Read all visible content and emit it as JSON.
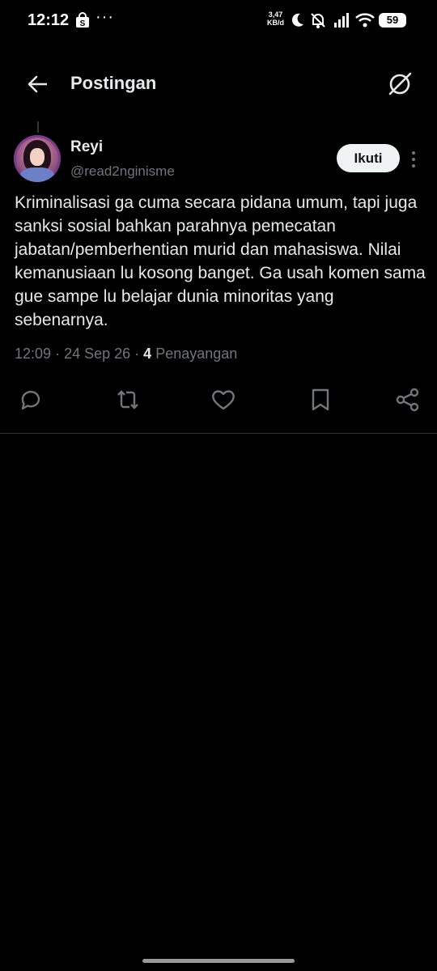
{
  "status_bar": {
    "time": "12:12",
    "dots": "···",
    "speed_value": "3,47",
    "speed_unit": "KB/d",
    "battery": "59",
    "icons": [
      "shopping-bag-icon",
      "moon-icon",
      "bell-off-icon",
      "signal-icon",
      "wifi-icon",
      "battery-icon"
    ]
  },
  "header": {
    "title": "Postingan",
    "back_icon": "arrow-left-icon",
    "grok_icon": "grok-icon"
  },
  "post": {
    "author": {
      "name": "Reyi",
      "handle": "@read2nginisme"
    },
    "follow_label": "Ikuti",
    "text": "Kriminalisasi ga cuma secara pidana umum, tapi juga sanksi sosial bahkan parahnya pemecatan jabatan/pemberhentian murid dan mahasiswa. Nilai kemanusiaan lu kosong banget. Ga usah komen sama gue sampe lu belajar dunia minoritas yang sebenarnya.",
    "time": "12:09",
    "date": "24 Sep 26",
    "views_count": "4",
    "views_label": "Penayangan"
  },
  "actions": [
    "reply-icon",
    "repost-icon",
    "like-icon",
    "bookmark-icon",
    "share-icon"
  ],
  "colors": {
    "background": "#000000",
    "text": "#e7e9ea",
    "muted": "#71767b",
    "follow_bg": "#eff3f4"
  }
}
